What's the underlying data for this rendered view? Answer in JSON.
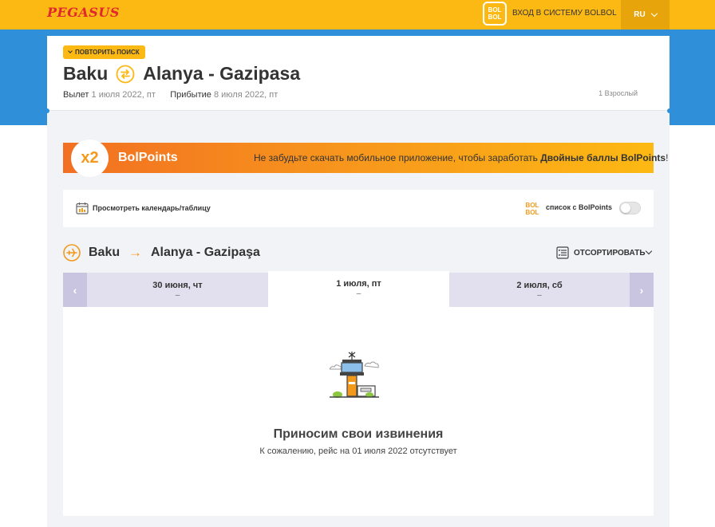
{
  "header": {
    "logo": "PEGASUS",
    "bolbol_badge": [
      "BOL",
      "BOL"
    ],
    "login_label": "ВХОД В СИСТЕМУ BOLBOL",
    "language": "RU"
  },
  "search": {
    "repeat_label": "ПОВТОРИТЬ ПОИСК",
    "origin": "Baku",
    "destination": "Alanya - Gazipasa",
    "departure_label": "Вылет",
    "departure_date": "1 июля 2022, пт",
    "arrival_label": "Прибытие",
    "arrival_date": "8 июля 2022, пт",
    "passengers": "1 Взрослый"
  },
  "bolpoints_banner": {
    "badge": "x2",
    "title": "BolPoints",
    "text": "Не забудьте скачать мобильное приложение, чтобы заработать ",
    "text_bold": "Двойные баллы BolPoints",
    "text_end": "!"
  },
  "options": {
    "calendar_link": "Просмотреть календарь/таблицу",
    "bp_logo": [
      "BOL",
      "BOL"
    ],
    "bolpoints_list_label": "список с BolPoints",
    "bolpoints_toggle": "off"
  },
  "flight": {
    "from": "Baku",
    "arrow": "→",
    "to": "Alanya - Gazipaşa",
    "sort_label": "ОТСОРТИРОВАТЬ"
  },
  "days": {
    "prev_glyph": "‹",
    "next_glyph": "›",
    "items": [
      {
        "label": "30 июня, чт",
        "price": "–"
      },
      {
        "label": "1 июля, пт",
        "price": "–"
      },
      {
        "label": "2 июля, сб",
        "price": "–"
      }
    ]
  },
  "empty_state": {
    "title": "Приносим свои извинения",
    "message": "К сожалению, рейс на 01 июля 2022 отсутствует"
  },
  "colors": {
    "brand_yellow": "#fdb913",
    "brand_blue": "#2f8fd8",
    "brand_red": "#e0262e",
    "orange": "#f39a1c"
  }
}
